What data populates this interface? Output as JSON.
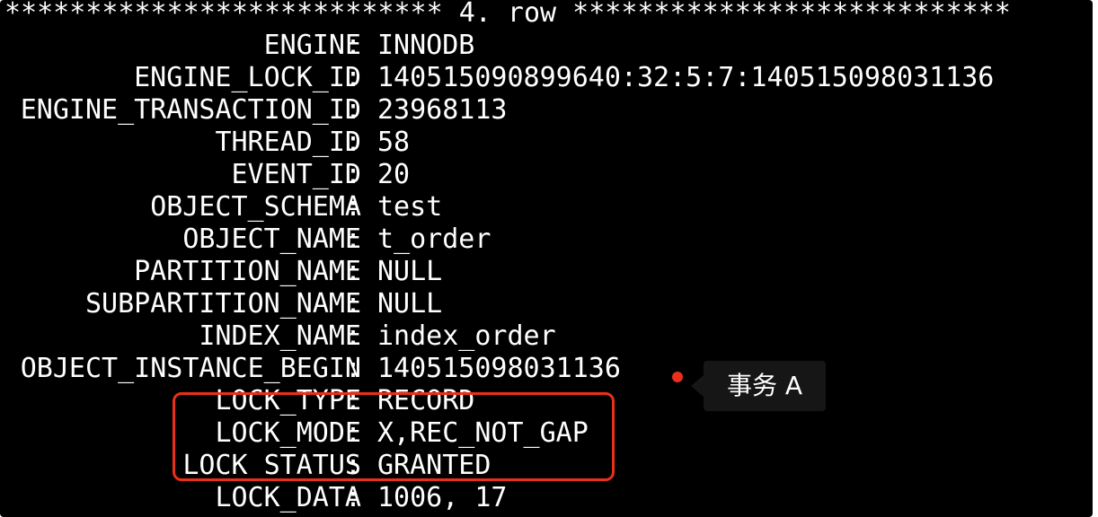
{
  "terminal": {
    "header": "*************************** 4. row ***************************",
    "rows": [
      {
        "key": "ENGINE",
        "value": "INNODB"
      },
      {
        "key": "ENGINE_LOCK_ID",
        "value": "140515090899640:32:5:7:140515098031136"
      },
      {
        "key": "ENGINE_TRANSACTION_ID",
        "value": "23968113"
      },
      {
        "key": "THREAD_ID",
        "value": "58"
      },
      {
        "key": "EVENT_ID",
        "value": "20"
      },
      {
        "key": "OBJECT_SCHEMA",
        "value": "test"
      },
      {
        "key": "OBJECT_NAME",
        "value": "t_order"
      },
      {
        "key": "PARTITION_NAME",
        "value": "NULL"
      },
      {
        "key": "SUBPARTITION_NAME",
        "value": "NULL"
      },
      {
        "key": "INDEX_NAME",
        "value": "index_order"
      },
      {
        "key": "OBJECT_INSTANCE_BEGIN",
        "value": "140515098031136"
      },
      {
        "key": "LOCK_TYPE",
        "value": "RECORD"
      },
      {
        "key": "LOCK_MODE",
        "value": "X,REC_NOT_GAP"
      },
      {
        "key": "LOCK_STATUS",
        "value": "GRANTED"
      },
      {
        "key": "LOCK_DATA",
        "value": "1006, 17"
      }
    ]
  },
  "annotation": {
    "label": "事务 A",
    "color": "#e8301a"
  }
}
